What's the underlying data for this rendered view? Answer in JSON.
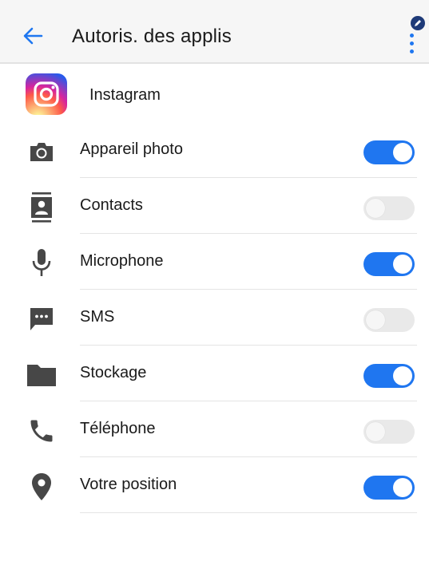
{
  "header": {
    "title": "Autoris. des applis",
    "back_icon": "arrow-left-icon",
    "menu_icon": "more-vertical-icon",
    "accent_color": "#1f77f0"
  },
  "app": {
    "name": "Instagram",
    "icon": "instagram-logo"
  },
  "permissions": [
    {
      "label": "Appareil photo",
      "icon": "camera-icon",
      "enabled": true
    },
    {
      "label": "Contacts",
      "icon": "contacts-icon",
      "enabled": false
    },
    {
      "label": "Microphone",
      "icon": "microphone-icon",
      "enabled": true
    },
    {
      "label": "SMS",
      "icon": "sms-icon",
      "enabled": false
    },
    {
      "label": "Stockage",
      "icon": "folder-icon",
      "enabled": true
    },
    {
      "label": "Téléphone",
      "icon": "phone-icon",
      "enabled": false
    },
    {
      "label": "Votre position",
      "icon": "location-pin-icon",
      "enabled": true
    }
  ],
  "colors": {
    "toggle_on": "#1f76f0",
    "toggle_off": "#e9e9e9",
    "icon_gray": "#474747"
  }
}
